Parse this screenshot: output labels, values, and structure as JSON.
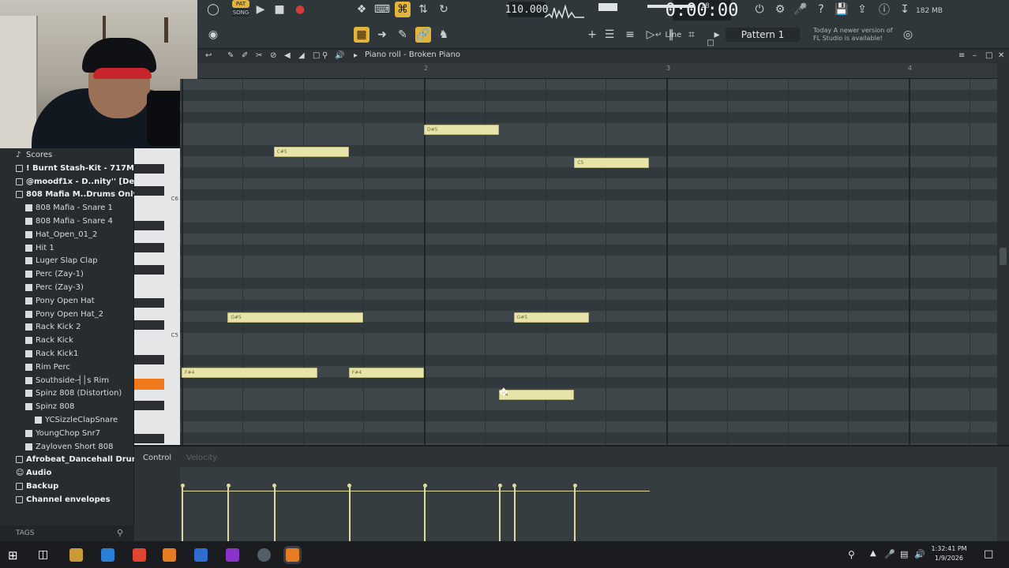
{
  "toolbar": {
    "tempo": "110.000",
    "time": "0:00:00",
    "cpu": "18",
    "memory": "182 MB",
    "snap_label": "Line",
    "pattern": "Pattern 1",
    "news": "Today  A newer version of FL Studio is available!"
  },
  "piano_roll": {
    "title": "Piano roll - Broken Piano",
    "bar_numbers": [
      "2",
      "3",
      "4"
    ],
    "key_labels": [
      "C6",
      "C5"
    ],
    "notes": [
      {
        "label": "D#5",
        "start": 2.0,
        "len": 0.31,
        "pitch_row": 3
      },
      {
        "label": "C#5",
        "start": 1.38,
        "len": 0.31,
        "pitch_row": 5
      },
      {
        "label": "C5",
        "start": 2.62,
        "len": 0.31,
        "pitch_row": 6
      },
      {
        "label": "G#5",
        "start": 1.19,
        "len": 0.56,
        "pitch_row": 20
      },
      {
        "label": "G#5",
        "start": 2.37,
        "len": 0.31,
        "pitch_row": 20
      },
      {
        "label": "F#4",
        "start": 1.0,
        "len": 0.56,
        "pitch_row": 25
      },
      {
        "label": "F#4",
        "start": 1.69,
        "len": 0.31,
        "pitch_row": 25
      },
      {
        "label": "F4",
        "start": 2.31,
        "len": 0.31,
        "pitch_row": 27
      }
    ]
  },
  "browser": {
    "items": [
      {
        "label": "Scores",
        "type": "music",
        "indent": 0,
        "bold": false
      },
      {
        "label": "! Burnt Stash-Kit - 717MaKid",
        "type": "folder",
        "indent": 0,
        "bold": true
      },
      {
        "label": "@moodf1x - D..nity'' [Demo]",
        "type": "folder",
        "indent": 0,
        "bold": true
      },
      {
        "label": "808 Mafia M..Drums Only)",
        "type": "folder-open",
        "indent": 0,
        "bold": true
      },
      {
        "label": "808 Mafia - Snare 1",
        "type": "sample",
        "indent": 1,
        "bold": false
      },
      {
        "label": "808 Mafia - Snare 4",
        "type": "sample",
        "indent": 1,
        "bold": false
      },
      {
        "label": "Hat_Open_01_2",
        "type": "sample",
        "indent": 1,
        "bold": false
      },
      {
        "label": "Hit 1",
        "type": "sample",
        "indent": 1,
        "bold": false
      },
      {
        "label": "Luger Slap Clap",
        "type": "sample",
        "indent": 1,
        "bold": false
      },
      {
        "label": "Perc (Zay-1)",
        "type": "sample",
        "indent": 1,
        "bold": false
      },
      {
        "label": "Perc (Zay-3)",
        "type": "sample",
        "indent": 1,
        "bold": false
      },
      {
        "label": "Pony Open Hat",
        "type": "sample",
        "indent": 1,
        "bold": false
      },
      {
        "label": "Pony Open Hat_2",
        "type": "sample",
        "indent": 1,
        "bold": false
      },
      {
        "label": "Rack Kick 2",
        "type": "sample",
        "indent": 1,
        "bold": false
      },
      {
        "label": "Rack Kick",
        "type": "sample",
        "indent": 1,
        "bold": false
      },
      {
        "label": "Rack Kick1",
        "type": "sample",
        "indent": 1,
        "bold": false
      },
      {
        "label": "Rim Perc",
        "type": "sample",
        "indent": 1,
        "bold": false
      },
      {
        "label": "Southside-┤│s Rim",
        "type": "sample",
        "indent": 1,
        "bold": false
      },
      {
        "label": "Spinz 808 (Distortion)",
        "type": "sample",
        "indent": 1,
        "bold": false
      },
      {
        "label": "Spinz 808",
        "type": "sample",
        "indent": 1,
        "bold": false
      },
      {
        "label": "YCSizzleClapSnare",
        "type": "sample",
        "indent": 2,
        "bold": false
      },
      {
        "label": "YoungChop Snr7",
        "type": "sample",
        "indent": 1,
        "bold": false
      },
      {
        "label": "Zayloven Short 808",
        "type": "sample",
        "indent": 1,
        "bold": false
      },
      {
        "label": "Afrobeat_Dancehall Drum Kit",
        "type": "folder",
        "indent": 0,
        "bold": true
      },
      {
        "label": "Audio",
        "type": "user",
        "indent": 0,
        "bold": true
      },
      {
        "label": "Backup",
        "type": "folder",
        "indent": 0,
        "bold": true
      },
      {
        "label": "Channel envelopes",
        "type": "folder",
        "indent": 0,
        "bold": true
      }
    ],
    "footer": "TAGS"
  },
  "control": {
    "label": "Control",
    "target": "Velocity",
    "velocities": [
      {
        "pos": 1.0,
        "value": 0.9
      },
      {
        "pos": 1.19,
        "value": 0.9
      },
      {
        "pos": 1.38,
        "value": 0.9
      },
      {
        "pos": 1.69,
        "value": 0.9
      },
      {
        "pos": 2.0,
        "value": 0.9
      },
      {
        "pos": 2.31,
        "value": 0.9
      },
      {
        "pos": 2.37,
        "value": 0.9
      },
      {
        "pos": 2.62,
        "value": 0.9
      }
    ]
  },
  "taskbar": {
    "time": "1:32:41 PM",
    "date": "1/9/2026"
  },
  "colors": {
    "accent": "#e2b43c",
    "note": "#e8e3a9",
    "highlight_key": "#f07a1a"
  }
}
